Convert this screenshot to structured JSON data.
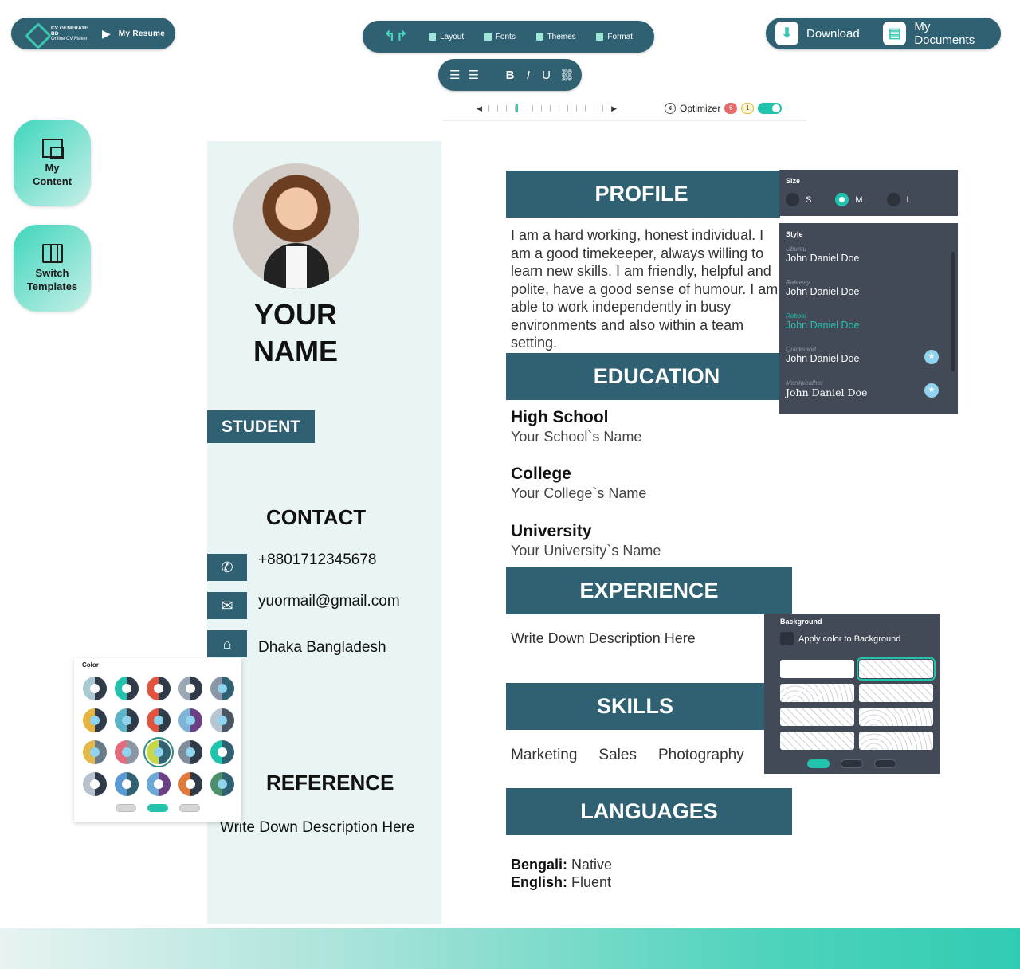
{
  "brand": {
    "logo_title": "CV GENERATE BD",
    "logo_sub": "Online CV Maker",
    "tab": "My Resume"
  },
  "toolbar": {
    "items": [
      "Layout",
      "Fonts",
      "Themes",
      "Format"
    ]
  },
  "format": {
    "bold": "B",
    "italic": "I",
    "underline": "U"
  },
  "actions": {
    "download": "Download",
    "documents": "My Documents"
  },
  "optimizer": {
    "label": "Optimizer",
    "errors": "6",
    "warnings": "1",
    "enabled": true
  },
  "sidebar": {
    "my_content": "My\nContent",
    "switch_templates": "Switch\nTemplates"
  },
  "cv": {
    "name_line1": "YOUR",
    "name_line2": "NAME",
    "role": "STUDENT",
    "contact_heading": "CONTACT",
    "phone": "+8801712345678",
    "email": "yuormail@gmail.com",
    "address": "Dhaka Bangladesh",
    "reference_heading": "REFERENCE",
    "reference_text": "Write Down Description Here",
    "profile_heading": "PROFILE",
    "profile_text": "I am a hard working, honest individual. I am a good timekeeper, always willing to learn new skills. I am friendly, helpful and polite, have a good sense of humour. I am able to work independently in busy environments and also within a team setting.",
    "education_heading": "EDUCATION",
    "education": [
      {
        "title": "High School",
        "sub": "Your School`s Name"
      },
      {
        "title": "College",
        "sub": "Your College`s Name"
      },
      {
        "title": "University",
        "sub": "Your University`s Name"
      }
    ],
    "experience_heading": "EXPERIENCE",
    "experience_text": "Write Down Description Here",
    "skills_heading": "SKILLS",
    "skills": [
      "Marketing",
      "Sales",
      "Photography"
    ],
    "languages_heading": "LANGUAGES",
    "languages": [
      {
        "lang": "Bengali:",
        "level": "Native"
      },
      {
        "lang": "English:",
        "level": "Fluent"
      }
    ]
  },
  "size_panel": {
    "title": "Size",
    "options": [
      "S",
      "M",
      "L"
    ],
    "selected": "M"
  },
  "style_panel": {
    "title": "Style",
    "fonts": [
      {
        "name": "Ubuntu",
        "sample": "John Daniel Doe"
      },
      {
        "name": "Raleway",
        "sample": "John Daniel Doe"
      },
      {
        "name": "Roboto",
        "sample": "John Daniel Doe"
      },
      {
        "name": "Quicksand",
        "sample": "John Daniel Doe"
      },
      {
        "name": "Merriweather",
        "sample": "John Daniel Doe"
      }
    ],
    "selected": "Roboto"
  },
  "background_panel": {
    "title": "Background",
    "apply_label": "Apply color to Background"
  },
  "color_panel": {
    "title": "Color"
  },
  "colors": {
    "accent": "#2f6173",
    "teal": "#21c3ad",
    "panel": "#424a57"
  }
}
